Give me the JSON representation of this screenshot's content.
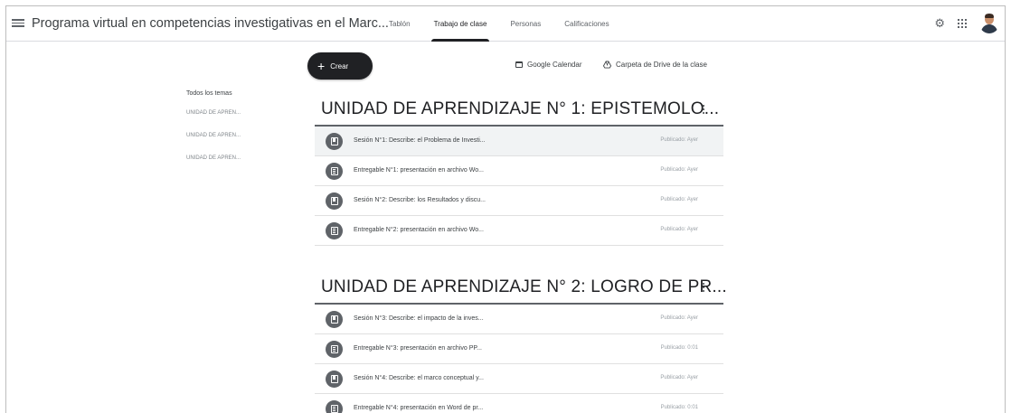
{
  "header": {
    "class_title": "Programa virtual en competencias investigativas en el Marc...",
    "tabs": [
      {
        "label": "Tablón"
      },
      {
        "label": "Trabajo de clase"
      },
      {
        "label": "Personas"
      },
      {
        "label": "Calificaciones"
      }
    ],
    "active_tab": "Trabajo de clase",
    "icons": [
      "menu-icon",
      "settings-icon",
      "apps-grid-icon",
      "avatar"
    ]
  },
  "actions": {
    "create_label": "Crear",
    "calendar_label": "Google Calendar",
    "drive_label": "Carpeta de Drive de la clase"
  },
  "topics": {
    "all_label": "Todos los temas",
    "items": [
      "UNIDAD DE APREN...",
      "UNIDAD DE APREN...",
      "UNIDAD DE APREN..."
    ]
  },
  "sections": [
    {
      "title": "UNIDAD DE APRENDIZAJE N° 1: EPISTEMOLO...",
      "items": [
        {
          "type": "material",
          "title": "Sesión N°1: Describe: el Problema de Investi...",
          "date": "Publicado: Ayer"
        },
        {
          "type": "assignment",
          "title": "Entregable N°1: presentación en archivo Wo...",
          "date": "Publicado: Ayer"
        },
        {
          "type": "material",
          "title": "Sesión N°2: Describe: los Resultados y discu...",
          "date": "Publicado: Ayer"
        },
        {
          "type": "assignment",
          "title": "Entregable N°2: presentación en archivo Wo...",
          "date": "Publicado: Ayer"
        }
      ]
    },
    {
      "title": "UNIDAD DE APRENDIZAJE N° 2: LOGRO DE PR...",
      "items": [
        {
          "type": "material",
          "title": "Sesión N°3: Describe: el impacto de la inves...",
          "date": "Publicado: Ayer"
        },
        {
          "type": "assignment",
          "title": "Entregable N°3: presentación en archivo PP...",
          "date": "Publicado: 0:01"
        },
        {
          "type": "material",
          "title": "Sesión N°4: Describe: el marco conceptual y...",
          "date": "Publicado: Ayer"
        },
        {
          "type": "assignment",
          "title": "Entregable N°4: presentación en Word de pr...",
          "date": "Publicado: 0:01"
        }
      ]
    }
  ]
}
